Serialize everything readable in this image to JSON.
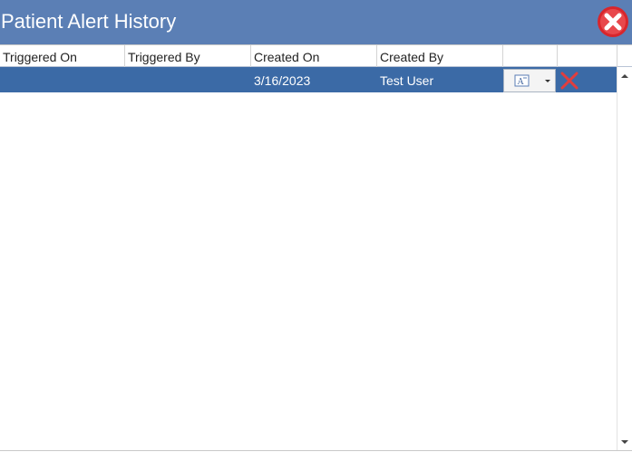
{
  "window": {
    "title": "Patient Alert History",
    "close_icon": "close-circle-icon"
  },
  "grid": {
    "columns": [
      {
        "label": "Triggered On"
      },
      {
        "label": "Triggered By"
      },
      {
        "label": "Created On"
      },
      {
        "label": "Created By"
      },
      {
        "label": ""
      },
      {
        "label": ""
      }
    ],
    "rows": [
      {
        "triggered_on": "",
        "triggered_by": "",
        "created_on": "3/16/2023",
        "created_by": "Test User",
        "action_icon": "document-dropdown-icon",
        "delete_icon": "delete-x-icon",
        "selected": true
      }
    ]
  },
  "colors": {
    "titlebar": "#5b7fb5",
    "selected_row": "#3b6aa6",
    "delete": "#e23d3d"
  }
}
